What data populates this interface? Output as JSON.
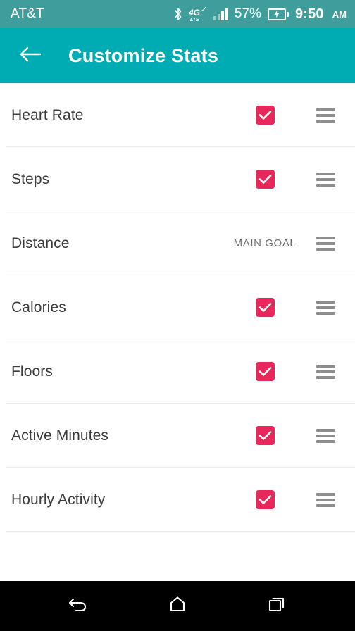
{
  "status_bar": {
    "carrier": "AT&T",
    "bluetooth_icon": "bluetooth-icon",
    "network_label": "4G",
    "network_sublabel": "LTE",
    "signal_icon": "signal-bars-icon",
    "battery_percent": "57%",
    "battery_icon": "battery-charging-icon",
    "time": "9:50",
    "time_period": "AM",
    "background_color": "#3f9e9c",
    "text_color": "#ffffff"
  },
  "app_bar": {
    "back_icon": "arrow-left-icon",
    "title": "Customize Stats",
    "background_color": "#00acb4",
    "text_color": "#ffffff"
  },
  "list": {
    "checkbox_color": "#e8275a",
    "divider_color": "#ececed",
    "drag_handle_icon": "drag-handle-icon",
    "check_icon": "check-icon",
    "rows": [
      {
        "label": "Heart Rate",
        "control": "checkbox",
        "checked": true
      },
      {
        "label": "Steps",
        "control": "checkbox",
        "checked": true
      },
      {
        "label": "Distance",
        "control": "text",
        "text": "MAIN GOAL"
      },
      {
        "label": "Calories",
        "control": "checkbox",
        "checked": true
      },
      {
        "label": "Floors",
        "control": "checkbox",
        "checked": true
      },
      {
        "label": "Active Minutes",
        "control": "checkbox",
        "checked": true
      },
      {
        "label": "Hourly Activity",
        "control": "checkbox",
        "checked": true
      }
    ]
  },
  "nav_bar": {
    "background_color": "#000000",
    "back_icon": "nav-back-icon",
    "home_icon": "nav-home-icon",
    "recents_icon": "nav-recents-icon"
  }
}
